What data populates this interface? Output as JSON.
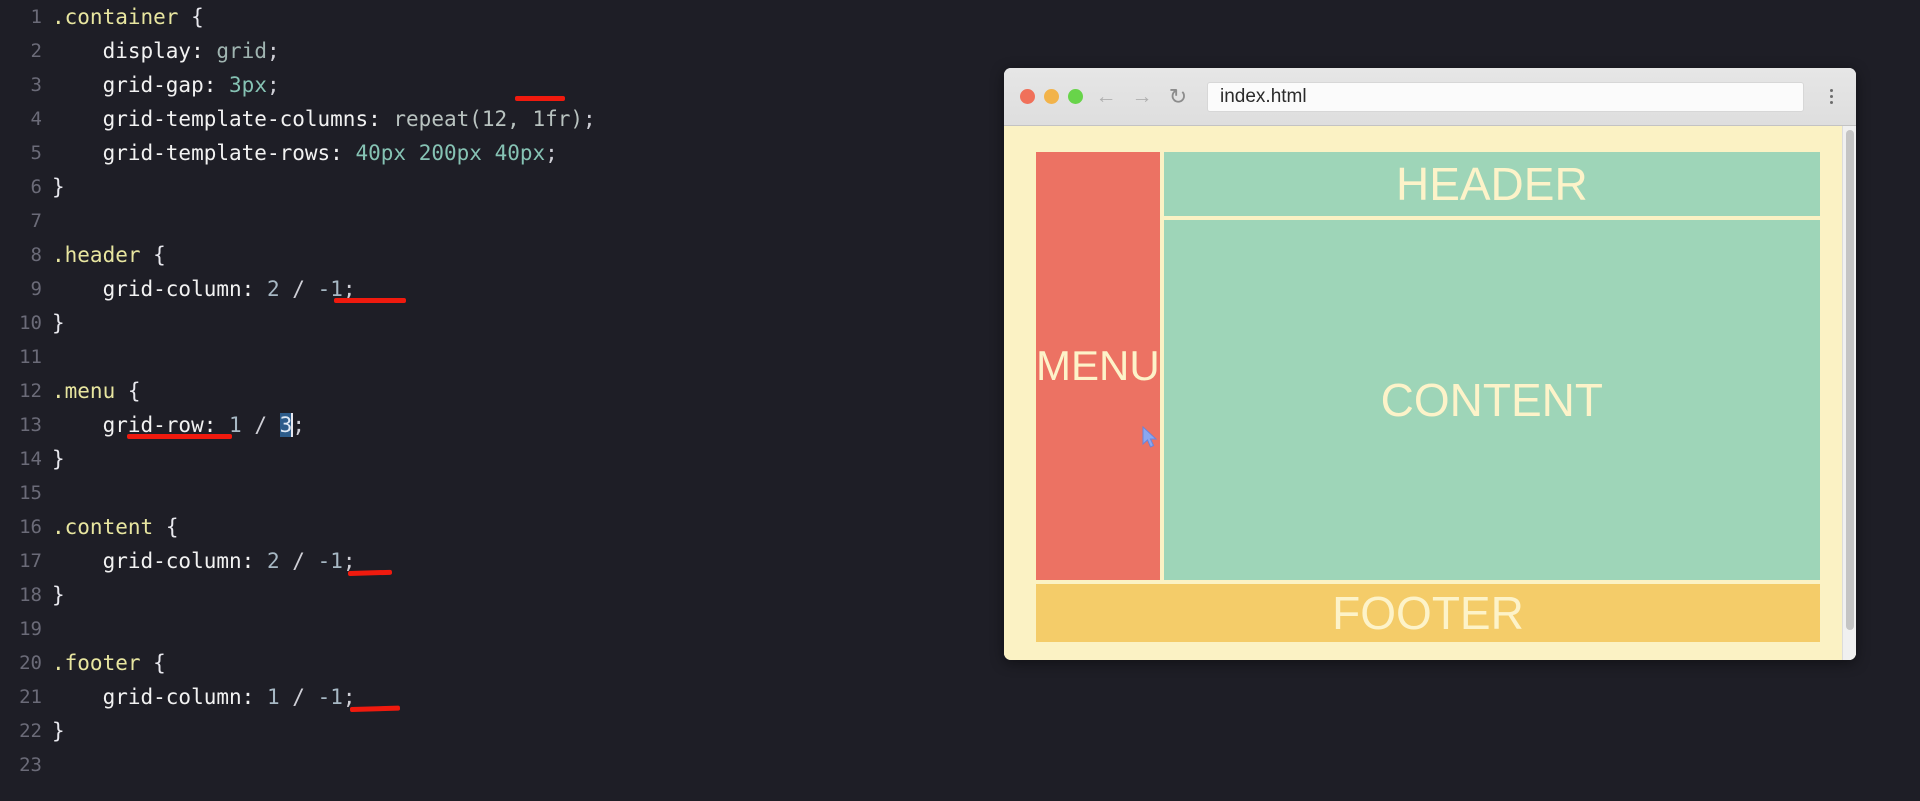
{
  "editor": {
    "language": "css",
    "total_lines": 23,
    "lines": [
      {
        "n": "1",
        "text": ".container {"
      },
      {
        "n": "2",
        "text": "    display: grid;"
      },
      {
        "n": "3",
        "text": "    grid-gap: 3px;"
      },
      {
        "n": "4",
        "text": "    grid-template-columns: repeat(12, 1fr);"
      },
      {
        "n": "5",
        "text": "    grid-template-rows: 40px 200px 40px;"
      },
      {
        "n": "6",
        "text": "}"
      },
      {
        "n": "7",
        "text": ""
      },
      {
        "n": "8",
        "text": ".header {"
      },
      {
        "n": "9",
        "text": "    grid-column: 2 / -1;"
      },
      {
        "n": "10",
        "text": "}"
      },
      {
        "n": "11",
        "text": ""
      },
      {
        "n": "12",
        "text": ".menu {"
      },
      {
        "n": "13",
        "text": "    grid-row: 1 / 3;"
      },
      {
        "n": "14",
        "text": "}"
      },
      {
        "n": "15",
        "text": ""
      },
      {
        "n": "16",
        "text": ".content {"
      },
      {
        "n": "17",
        "text": "    grid-column: 2 / -1;"
      },
      {
        "n": "18",
        "text": "}"
      },
      {
        "n": "19",
        "text": ""
      },
      {
        "n": "20",
        "text": ".footer {"
      },
      {
        "n": "21",
        "text": "    grid-column: 1 / -1;"
      },
      {
        "n": "22",
        "text": "}"
      },
      {
        "n": "23",
        "text": ""
      }
    ],
    "tokens": {
      "sel_container": ".container",
      "sel_header": ".header",
      "sel_menu": ".menu",
      "sel_content": ".content",
      "sel_footer": ".footer",
      "brace_open": "{",
      "brace_close": "}",
      "prop_display": "display:",
      "val_grid": "grid",
      "prop_grid_gap": "grid-gap:",
      "val_3px": "3px",
      "prop_grid_template_columns": "grid-template-columns:",
      "val_repeat": "repeat(12, 1fr)",
      "prop_grid_template_rows": "grid-template-rows:",
      "val_40px_a": "40px",
      "val_200px": "200px",
      "val_40px_b": "40px",
      "prop_grid_column": "grid-column:",
      "prop_grid_row": "grid-row:",
      "v2": "2",
      "v1": "1",
      "vneg1": "-1",
      "v3": "3",
      "slash": "/",
      "semi": ";"
    },
    "selection": {
      "selected_text": "3",
      "line": "13"
    },
    "annotation_color": "#f01a0e",
    "annotation_count": 5
  },
  "browser": {
    "url": "index.html",
    "traffic_lights": [
      "close",
      "minimize",
      "zoom"
    ],
    "back_icon": "←",
    "forward_icon": "→",
    "reload_icon": "↻",
    "menu_icon": "kebab-menu-icon",
    "page": {
      "background": "#fbf2c4",
      "blocks": [
        {
          "name": "MENU",
          "label": "MENU",
          "color": "#ec7263"
        },
        {
          "name": "HEADER",
          "label": "HEADER",
          "color": "#9ed5b8"
        },
        {
          "name": "CONTENT",
          "label": "CONTENT",
          "color": "#9ed5b8"
        },
        {
          "name": "FOOTER",
          "label": "FOOTER",
          "color": "#f4cc69"
        }
      ],
      "text_color": "#fdf3c9"
    }
  },
  "theme": {
    "editor_background": "#1e1e26",
    "gutter_color": "#6b6b78",
    "selector_color": "#e8e6a0",
    "number_color": "#86c3b4",
    "selection_background": "#2d5c8a"
  }
}
